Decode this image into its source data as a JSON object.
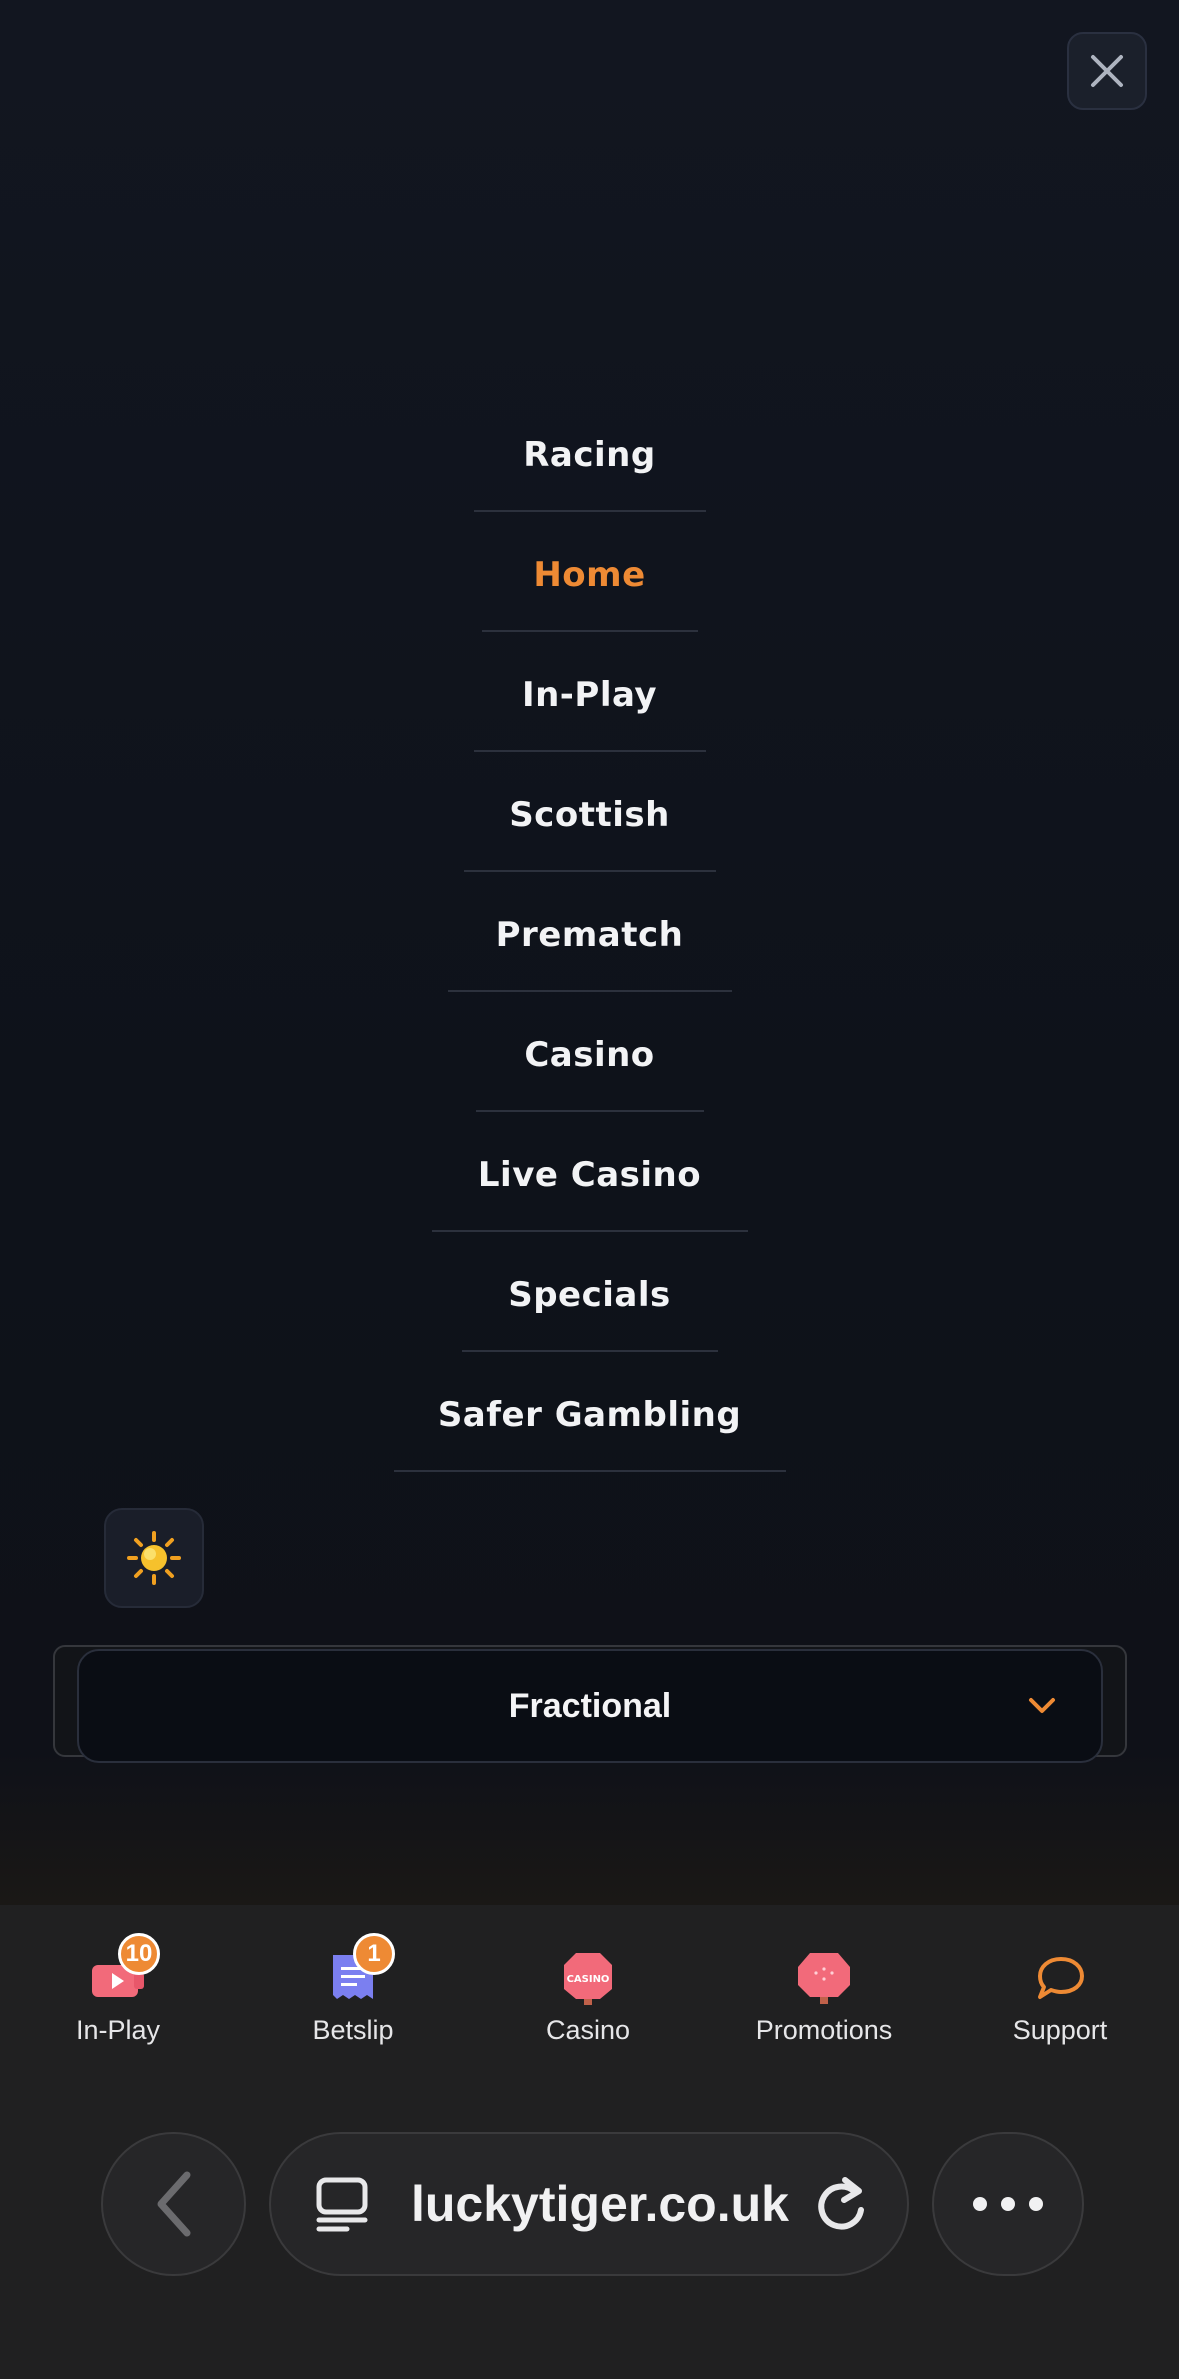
{
  "menu": {
    "close_label": "close",
    "items": [
      {
        "label": "Racing",
        "active": false
      },
      {
        "label": "Home",
        "active": true
      },
      {
        "label": "In-Play",
        "active": false
      },
      {
        "label": "Scottish",
        "active": false
      },
      {
        "label": "Prematch",
        "active": false
      },
      {
        "label": "Casino",
        "active": false
      },
      {
        "label": "Live Casino",
        "active": false
      },
      {
        "label": "Specials",
        "active": false
      },
      {
        "label": "Safer Gambling",
        "active": false
      }
    ],
    "active_color": "#ee8a34",
    "theme_icon": "sun-icon",
    "odds_format": {
      "selected": "Fractional",
      "icon": "chevron-down-icon"
    }
  },
  "tabbar": {
    "items": [
      {
        "label": "In-Play",
        "icon": "live-video-icon",
        "badge": "10"
      },
      {
        "label": "Betslip",
        "icon": "receipt-icon",
        "badge": "1"
      },
      {
        "label": "Casino",
        "icon": "casino-chip-icon",
        "icon_text": "CASINO"
      },
      {
        "label": "Promotions",
        "icon": "promotions-icon"
      },
      {
        "label": "Support",
        "icon": "chat-bubble-icon"
      }
    ]
  },
  "browser": {
    "url": "luckytiger.co.uk",
    "icons": [
      "back-arrow-icon",
      "tabs-icon",
      "reload-icon",
      "more-icon"
    ]
  }
}
